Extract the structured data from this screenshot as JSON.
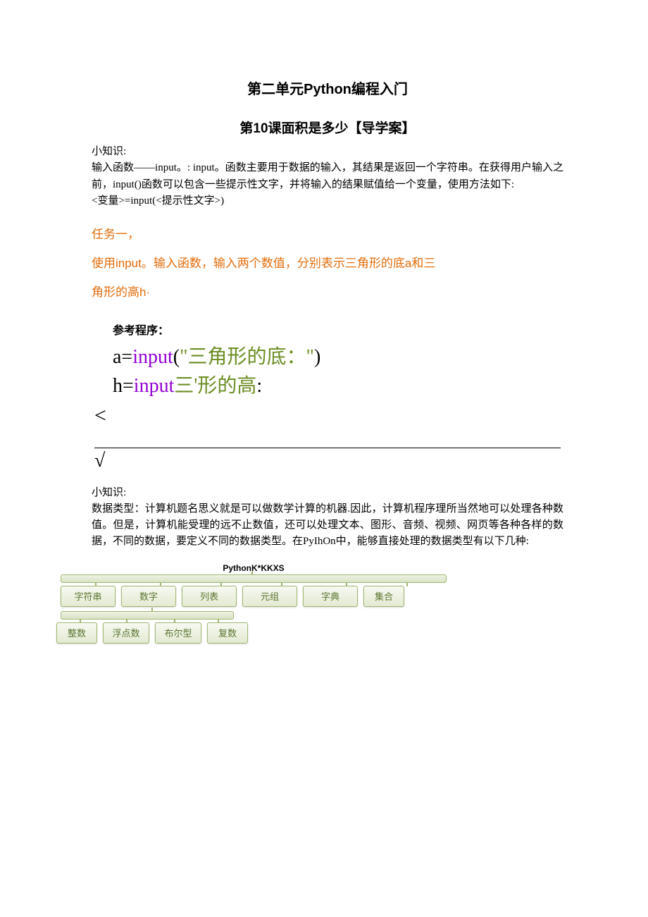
{
  "header": {
    "unit_title": "第二单元Python编程入门",
    "lesson_title": "第10课面积是多少【导学案】"
  },
  "knowledge1": {
    "label": "小知识:",
    "para": "输入函数——input。: input。函数主要用于数据的输入，其结果是返回一个字符串。在获得用户输入之前，input()函数可以包含一些提示性文字，并将输入的结果赋值给一个变量，使用方法如下:",
    "syntax": "<变量>=input(<提示性文字>)"
  },
  "task1": {
    "heading": "任务一，",
    "line1": "使用input。输入函数，输入两个数值，分别表示三角形的底a和三",
    "line2": "角形的高h·"
  },
  "refprog": {
    "label": "参考程序：",
    "l1_a": "a=",
    "l1_b": "input",
    "l1_c": "(",
    "l1_d": "\"三角形的底：\"",
    "l1_e": ")",
    "l2_a": "h=",
    "l2_b": "input",
    "l2_c": "三'形的高",
    "l2_d": ":",
    "lt": "<",
    "check": "√"
  },
  "knowledge2": {
    "label": "小知识:",
    "para": "数据类型：计算机题名思义就是可以做数学计算的机器.因此，计算机程序理所当然地可以处理各种数值。但是，计算机能受理的远不止数值，还可以处理文本、图形、音频、视频、网页等各种各样的数据，不同的数据，要定义不同的数据类型。在PyIhOn中，能够直接处理的数据类型有以下几种:"
  },
  "diagram": {
    "title": "PythonK*KKXS",
    "row1": [
      "字符串",
      "数字",
      "列表",
      "元组",
      "字典",
      "集合"
    ],
    "row2": [
      "整数",
      "浮点数",
      "布尔型",
      "复数"
    ]
  }
}
